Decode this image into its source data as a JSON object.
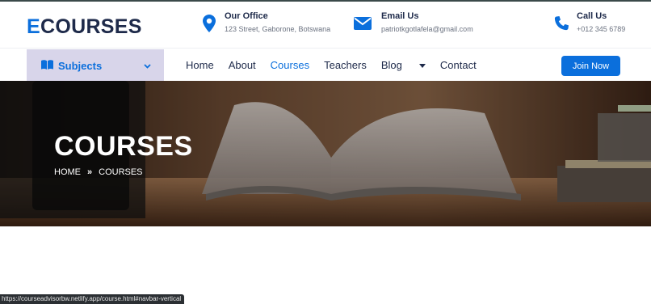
{
  "brand": {
    "logo_first": "E",
    "logo_rest": "COURSES"
  },
  "contacts": [
    {
      "title": "Our Office",
      "detail": "123 Street, Gaborone, Botswana",
      "icon": "map-pin-icon"
    },
    {
      "title": "Email Us",
      "detail": "patriotkgotlafela@gmail.com",
      "icon": "envelope-icon"
    },
    {
      "title": "Call Us",
      "detail": "+012 345 6789",
      "icon": "phone-icon"
    }
  ],
  "nav": {
    "subjects_label": "Subjects",
    "items": [
      "Home",
      "About",
      "Courses",
      "Teachers",
      "Blog",
      "Contact"
    ],
    "active": "Courses",
    "cta": "Join Now"
  },
  "hero": {
    "title": "COURSES",
    "breadcrumb": [
      "HOME",
      "COURSES"
    ]
  },
  "status_url": "https://courseadvisorbw.netlify.app/course.html#navbar-vertical",
  "colors": {
    "primary": "#0b6fdc",
    "dark": "#1e2a4a",
    "subjects_bg": "#d8d5ea"
  }
}
